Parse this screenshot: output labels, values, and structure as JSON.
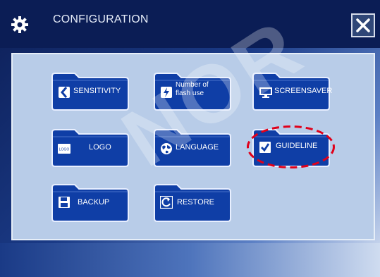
{
  "window": {
    "title": "CONFIGURATION",
    "close_icon": "close-icon",
    "settings_icon": "gear-icon"
  },
  "buttons": [
    {
      "id": "sensitivity",
      "label": "SENSITIVITY",
      "icon": "sensitivity-icon"
    },
    {
      "id": "flash",
      "label_line1": "Number of",
      "label_line2": "flash use",
      "icon": "flash-icon"
    },
    {
      "id": "screensaver",
      "label": "SCREENSAVER",
      "icon": "monitor-icon"
    },
    {
      "id": "logo",
      "label": "LOGO",
      "icon": "logo-icon",
      "icon_text": "LOGO"
    },
    {
      "id": "language",
      "label": "LANGUAGE",
      "icon": "globe-icon"
    },
    {
      "id": "guideline",
      "label": "GUIDELINE",
      "icon": "checkbox-checked-icon",
      "highlighted": true
    },
    {
      "id": "backup",
      "label": "BACKUP",
      "icon": "save-icon"
    },
    {
      "id": "restore",
      "label": "RESTORE",
      "icon": "restore-icon"
    }
  ],
  "watermark": "NOR",
  "colors": {
    "titlebar": "#0b1d55",
    "panel": "#b8cce8",
    "button": "#0f3ea6",
    "highlight": "#e0001a"
  }
}
